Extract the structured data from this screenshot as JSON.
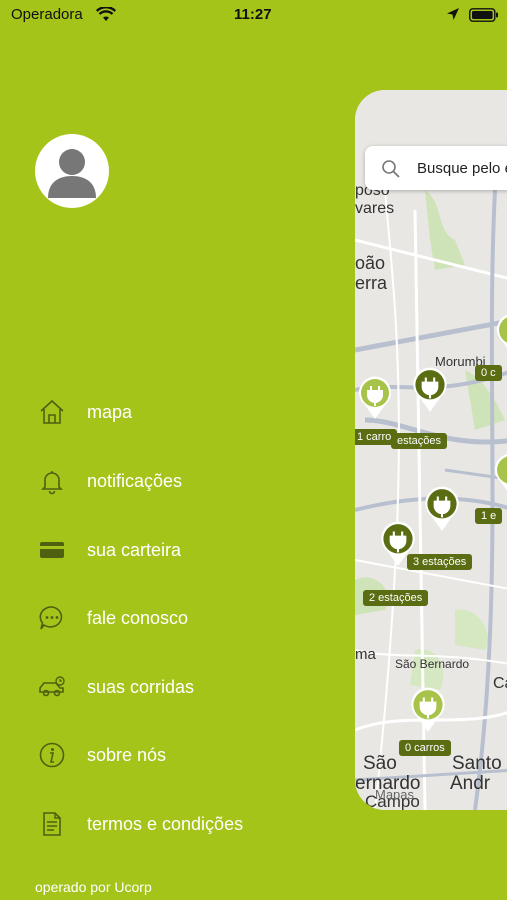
{
  "status_bar": {
    "carrier": "Operadora",
    "time": "11:27"
  },
  "menu": {
    "items": [
      {
        "label": "mapa",
        "icon": "home-icon"
      },
      {
        "label": "notificações",
        "icon": "bell-icon"
      },
      {
        "label": "sua carteira",
        "icon": "card-icon"
      },
      {
        "label": "fale conosco",
        "icon": "chat-icon"
      },
      {
        "label": "suas corridas",
        "icon": "car-icon"
      },
      {
        "label": "sobre nós",
        "icon": "info-icon"
      },
      {
        "label": "termos e condições",
        "icon": "document-icon"
      }
    ],
    "footer": "operado por Ucorp"
  },
  "map": {
    "search_placeholder": "Busque pelo e",
    "labels": {
      "poso": "poso",
      "vares": "vares",
      "joao": "oão",
      "serra": "erra",
      "morumbi": "Morumbi",
      "sao_bernardo": "São Bernardo",
      "ma": "ma",
      "ca": "Ca",
      "sao": "São",
      "bernardo": "ernardo",
      "campo": "Campo",
      "santo": "Santo",
      "andre": "Andr",
      "mapas": "Mapas"
    },
    "pills": {
      "p1": "1 carro",
      "p2": "estações",
      "p3": "3 estações",
      "p4": "2 estações",
      "p5": "0 carros",
      "p6": "0 c",
      "p7": "1 e"
    },
    "colors": {
      "pin_dark": "#5a6d13",
      "pin_light": "#a8c34a"
    }
  },
  "colors": {
    "background": "#a4c41a",
    "text": "#ffffff"
  }
}
